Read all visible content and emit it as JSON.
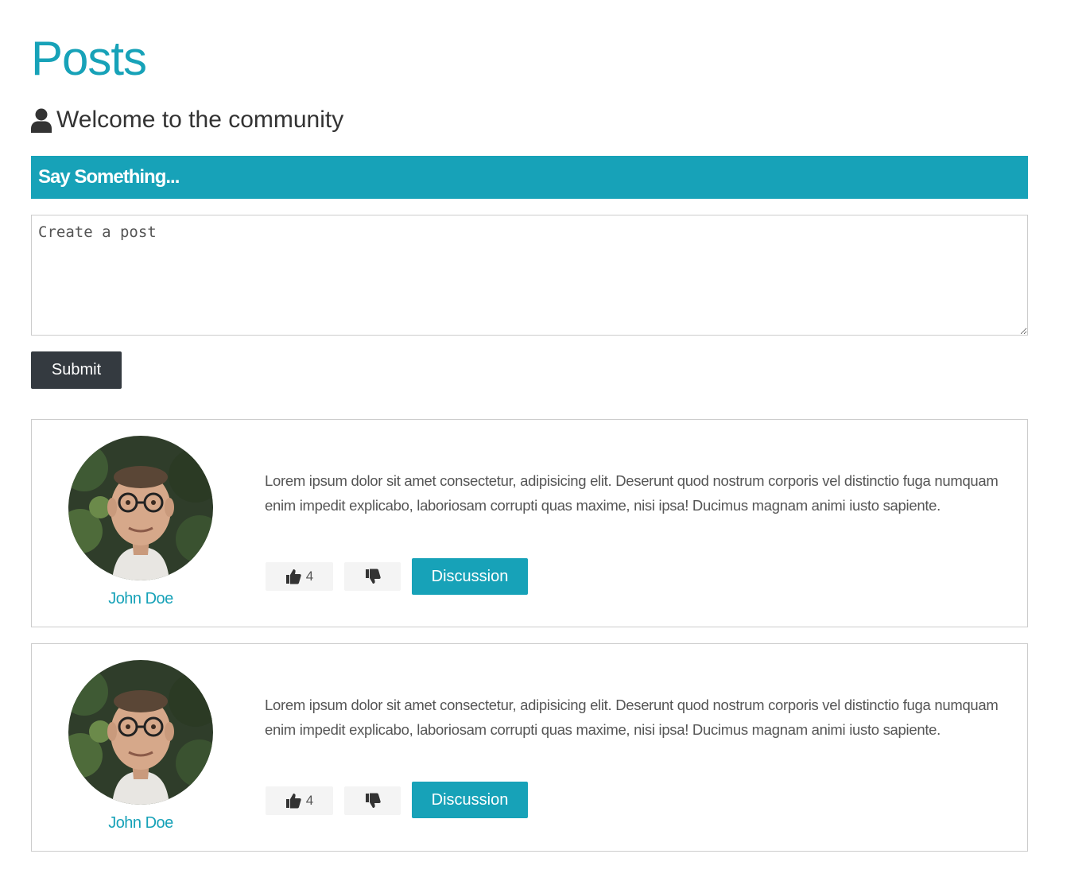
{
  "page": {
    "title": "Posts",
    "lead": "Welcome to the community",
    "lead_icon": "user-icon"
  },
  "composer": {
    "header": "Say Something...",
    "placeholder": "Create a post",
    "value": "",
    "submit_label": "Submit"
  },
  "colors": {
    "accent": "#17a2b8",
    "dark_button": "#343a40",
    "light_button": "#f4f4f4",
    "border": "#cccccc"
  },
  "posts": [
    {
      "author": "John Doe",
      "avatar": "profile-photo",
      "text": "Lorem ipsum dolor sit amet consectetur, adipisicing elit. Deserunt quod nostrum corporis vel distinctio fuga numquam enim impedit explicabo, laboriosam corrupti quas maxime, nisi ipsa! Ducimus magnam animi iusto sapiente.",
      "likes": "4",
      "like_icon": "thumbs-up-icon",
      "dislike_icon": "thumbs-down-icon",
      "discussion_label": "Discussion"
    },
    {
      "author": "John Doe",
      "avatar": "profile-photo",
      "text": "Lorem ipsum dolor sit amet consectetur, adipisicing elit. Deserunt quod nostrum corporis vel distinctio fuga numquam enim impedit explicabo, laboriosam corrupti quas maxime, nisi ipsa! Ducimus magnam animi iusto sapiente.",
      "likes": "4",
      "like_icon": "thumbs-up-icon",
      "dislike_icon": "thumbs-down-icon",
      "discussion_label": "Discussion"
    }
  ]
}
